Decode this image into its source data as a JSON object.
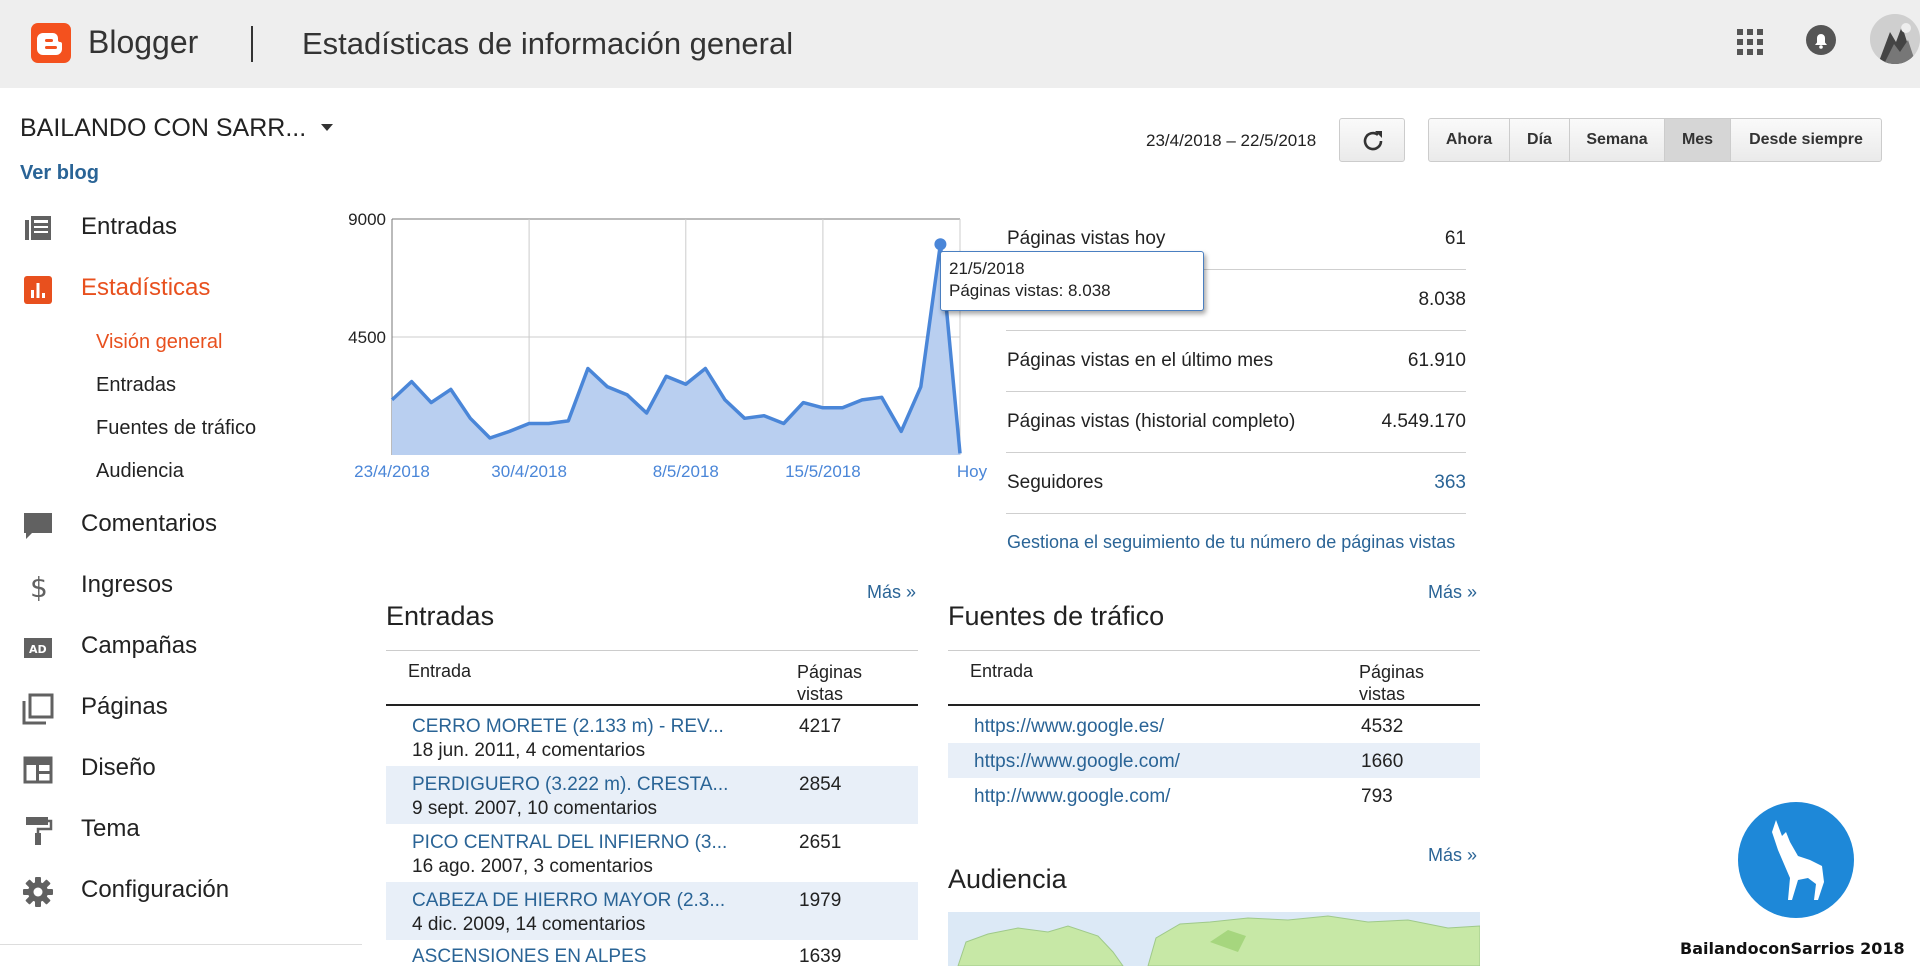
{
  "header": {
    "brand": "Blogger",
    "title": "Estadísticas de información general"
  },
  "sidebar": {
    "blog_name": "BAILANDO CON SARR...",
    "view_blog": "Ver blog",
    "items": [
      {
        "label": "Entradas",
        "icon": "posts-icon"
      },
      {
        "label": "Estadísticas",
        "icon": "stats-icon",
        "active": true
      },
      {
        "label": "Comentarios",
        "icon": "comments-icon"
      },
      {
        "label": "Ingresos",
        "icon": "dollar-icon"
      },
      {
        "label": "Campañas",
        "icon": "ad-icon"
      },
      {
        "label": "Páginas",
        "icon": "pages-icon"
      },
      {
        "label": "Diseño",
        "icon": "layout-icon"
      },
      {
        "label": "Tema",
        "icon": "paint-roller-icon"
      },
      {
        "label": "Configuración",
        "icon": "gear-icon"
      }
    ],
    "subitems": [
      {
        "label": "Visión general",
        "active": true
      },
      {
        "label": "Entradas"
      },
      {
        "label": "Fuentes de tráfico"
      },
      {
        "label": "Audiencia"
      }
    ]
  },
  "range": {
    "dates": "23/4/2018 – 22/5/2018",
    "buttons": [
      "Ahora",
      "Día",
      "Semana",
      "Mes",
      "Desde siempre"
    ],
    "selected": "Mes"
  },
  "chart_data": {
    "type": "area",
    "title": "",
    "ylim": [
      0,
      9000
    ],
    "yticks": [
      "9000",
      "4500"
    ],
    "xtick_labels": [
      "23/4/2018",
      "30/4/2018",
      "8/5/2018",
      "15/5/2018",
      "Hoy"
    ],
    "x": [
      "23/4",
      "24/4",
      "25/4",
      "26/4",
      "27/4",
      "28/4",
      "29/4",
      "30/4",
      "1/5",
      "2/5",
      "3/5",
      "4/5",
      "5/5",
      "6/5",
      "7/5",
      "8/5",
      "9/5",
      "10/5",
      "11/5",
      "12/5",
      "13/5",
      "14/5",
      "15/5",
      "16/5",
      "17/5",
      "18/5",
      "19/5",
      "20/5",
      "21/5",
      "22/5"
    ],
    "values": [
      2100,
      2800,
      2000,
      2500,
      1400,
      650,
      900,
      1200,
      1200,
      1300,
      3300,
      2600,
      2300,
      1600,
      3000,
      2700,
      3300,
      2100,
      1400,
      1500,
      1200,
      2000,
      1800,
      1800,
      2100,
      2200,
      900,
      2600,
      8038,
      61
    ],
    "color": "#4a86d8",
    "fill": "#b9cff0",
    "tooltip": {
      "date": "21/5/2018",
      "text": "Páginas vistas: 8.038"
    }
  },
  "stats": [
    {
      "label": "Páginas vistas hoy",
      "value": "61"
    },
    {
      "label": "",
      "value": "8.038"
    },
    {
      "label": "Páginas vistas en el último mes",
      "value": "61.910"
    },
    {
      "label": "Páginas vistas (historial completo)",
      "value": "4.549.170"
    },
    {
      "label": "Seguidores",
      "value": "363",
      "link": true
    }
  ],
  "manage_link": "Gestiona el seguimiento de tu número de páginas vistas",
  "entries": {
    "title": "Entradas",
    "more": "Más »",
    "col1": "Entrada",
    "col2": "Páginas vistas",
    "rows": [
      {
        "title": "CERRO MORETE (2.133 m) - REV...",
        "meta": "18 jun. 2011, 4 comentarios",
        "views": "4217"
      },
      {
        "title": "PERDIGUERO (3.222 m). CRESTA...",
        "meta": "9 sept. 2007, 10 comentarios",
        "views": "2854"
      },
      {
        "title": "PICO CENTRAL DEL INFIERNO (3...",
        "meta": "16 ago. 2007, 3 comentarios",
        "views": "2651"
      },
      {
        "title": "CABEZA DE HIERRO MAYOR (2.3...",
        "meta": "4 dic. 2009, 14 comentarios",
        "views": "1979"
      },
      {
        "title": "ASCENSIONES EN ALPES",
        "meta": "",
        "views": "1639"
      }
    ]
  },
  "traffic": {
    "title": "Fuentes de tráfico",
    "more": "Más »",
    "col1": "Entrada",
    "col2": "Páginas vistas",
    "rows": [
      {
        "source": "https://www.google.es/",
        "views": "4532"
      },
      {
        "source": "https://www.google.com/",
        "views": "1660"
      },
      {
        "source": "http://www.google.com/",
        "views": "793"
      }
    ]
  },
  "audience": {
    "title": "Audiencia",
    "more": "Más »"
  },
  "watermark": {
    "text": "BailandoconSarrios 2018"
  }
}
